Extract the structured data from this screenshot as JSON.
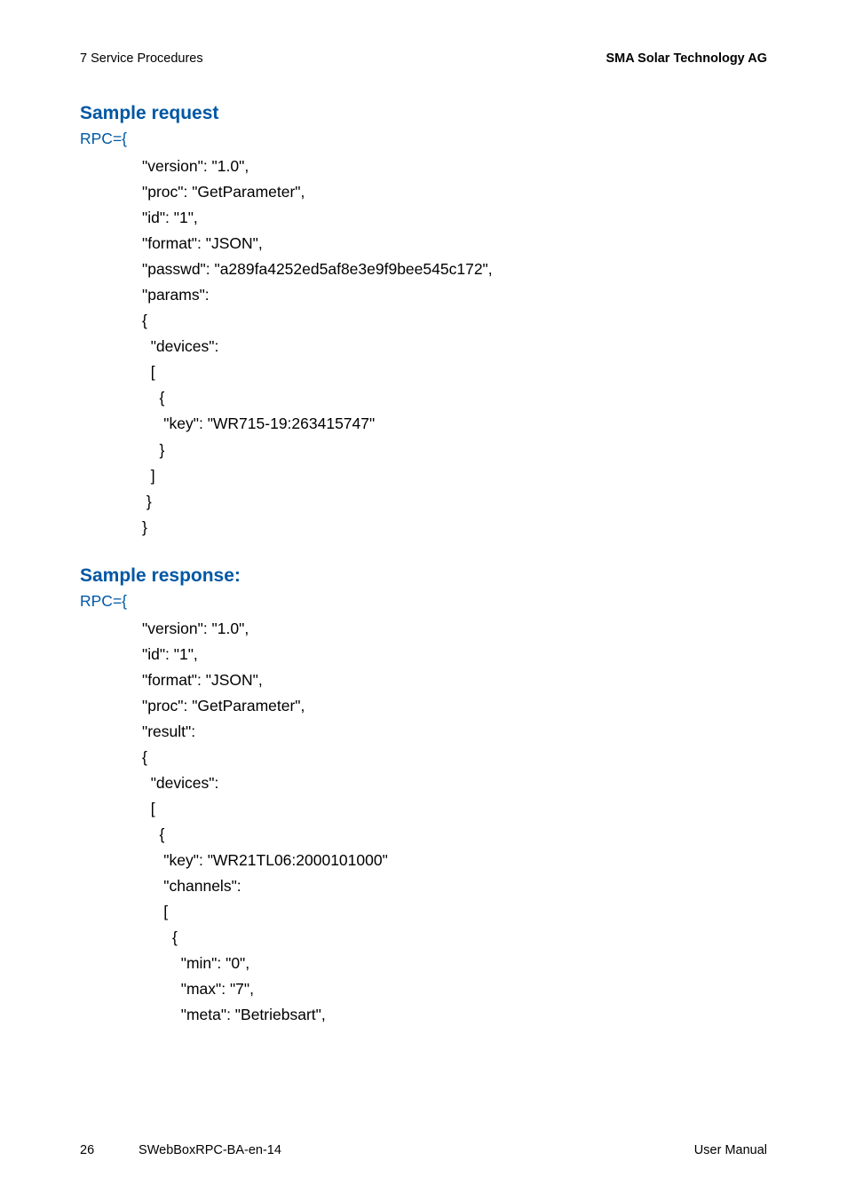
{
  "header": {
    "section": "7  Service Procedures",
    "company": "SMA Solar Technology AG"
  },
  "req": {
    "heading": "Sample request",
    "rpc_label": "RPC={",
    "lines": [
      "\"version\": \"1.0\",",
      "\"proc\": \"GetParameter\",",
      "\"id\": \"1\",",
      "\"format\": \"JSON\",",
      "\"passwd\": \"a289fa4252ed5af8e3e9f9bee545c172\",",
      "\"params\":",
      "{",
      "  \"devices\":",
      "  [",
      "    {",
      "     \"key\": \"WR715-19:263415747\"",
      "    }",
      "  ]",
      " }",
      "}"
    ]
  },
  "res": {
    "heading": "Sample response:",
    "rpc_label": "RPC={",
    "lines": [
      "\"version\": \"1.0\",",
      "\"id\": \"1\",",
      "\"format\": \"JSON\",",
      "\"proc\": \"GetParameter\",",
      "\"result\":",
      "{",
      "  \"devices\":",
      "  [",
      "    {",
      "     \"key\": \"WR21TL06:2000101000\"",
      "     \"channels\":",
      "     [",
      "       {",
      "         \"min\": \"0\",",
      "         \"max\": \"7\",",
      "         \"meta\": \"Betriebsart\","
    ]
  },
  "footer": {
    "page": "26",
    "docid": "SWebBoxRPC-BA-en-14",
    "label": "User Manual"
  }
}
